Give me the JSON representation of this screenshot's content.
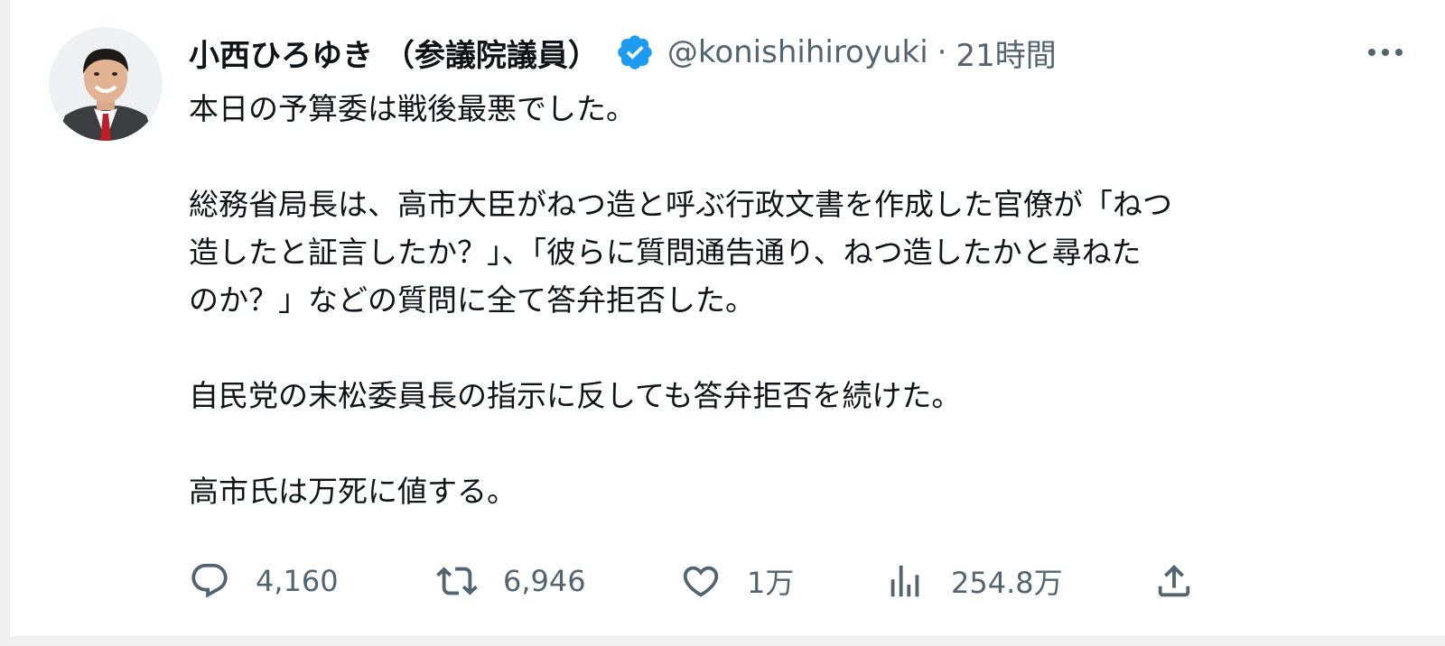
{
  "tweet": {
    "display_name": "小西ひろゆき （参議院議員）",
    "handle": "@konishihiroyuki",
    "separator": "·",
    "time": "21時間",
    "verified_icon": "verified-badge-icon",
    "more_icon": "more-dots-icon",
    "paragraphs": [
      {
        "lines": [
          "本日の予算委は戦後最悪でした。"
        ]
      },
      {
        "lines": [
          "総務省局長は、高市大臣がねつ造と呼ぶ行政文書を作成した官僚が「ねつ",
          "造したと証言したか？」、「彼らに質問通告通り、ねつ造したかと尋ねた",
          "のか？」などの質問に全て答弁拒否した。"
        ]
      },
      {
        "lines": [
          "自民党の末松委員長の指示に反しても答弁拒否を続けた。"
        ]
      },
      {
        "lines": [
          "高市氏は万死に値する。"
        ]
      }
    ]
  },
  "actions": {
    "reply": {
      "icon": "reply-icon",
      "count": "4,160"
    },
    "retweet": {
      "icon": "retweet-icon",
      "count": "6,946"
    },
    "like": {
      "icon": "heart-icon",
      "count": "1万"
    },
    "views": {
      "icon": "views-chart-icon",
      "count": "254.8万"
    },
    "share": {
      "icon": "share-icon"
    }
  },
  "colors": {
    "text": "#0f1419",
    "secondary": "#536471",
    "verified_blue": "#1d9bf0",
    "background": "#ffffff"
  }
}
